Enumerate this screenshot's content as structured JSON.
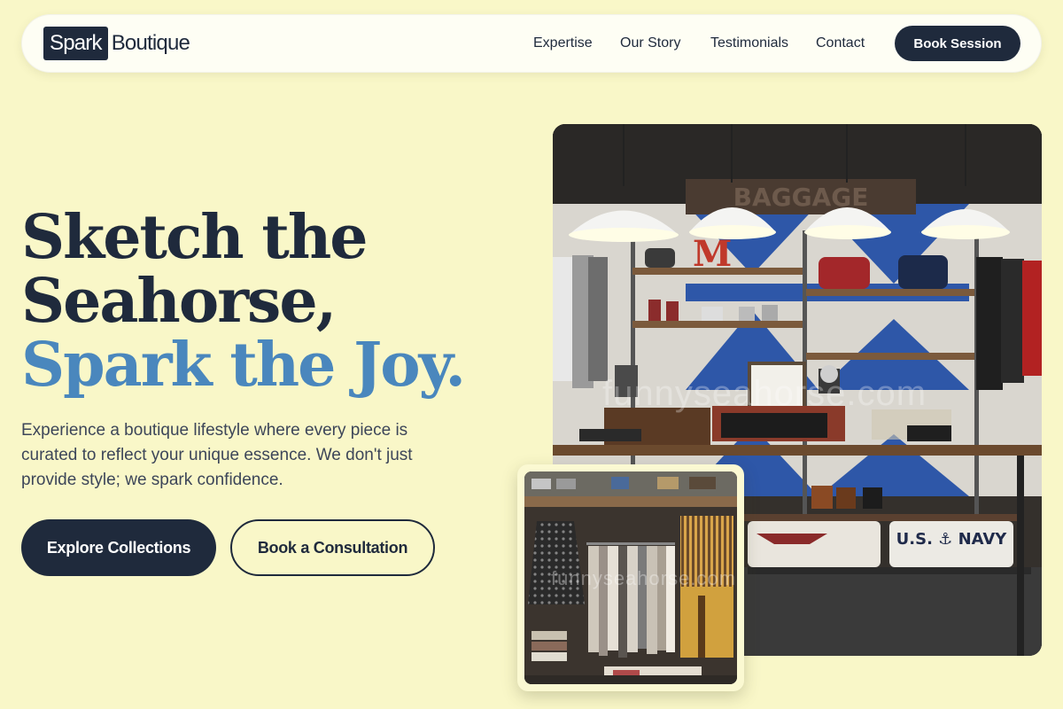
{
  "nav": {
    "logo_box": "Spark",
    "logo_text": "Boutique",
    "links": [
      "Expertise",
      "Our Story",
      "Testimonials",
      "Contact"
    ],
    "cta": "Book Session"
  },
  "hero": {
    "title_line1": "Sketch the",
    "title_line2": "Seahorse,",
    "title_accent": "Spark the Joy.",
    "description": "Experience a boutique lifestyle where every piece is curated to reflect your unique essence. We don't just provide style; we spark confidence.",
    "primary_button": "Explore Collections",
    "secondary_button": "Book a Consultation"
  },
  "images": {
    "main_alt": "Boutique store interior with pendant lamps and shelves",
    "sub_alt": "Clothing rack with dresses",
    "watermark": "funnyseahorse.com",
    "watermark_sub": "funnyseahorse.com",
    "signage": "BAGGAGE",
    "shirt_text": "U.S. ⚓ NAVY",
    "display_letter": "M"
  },
  "colors": {
    "background": "#f9f7c8",
    "navy": "#1f2a3c",
    "accent_blue": "#4a87bd"
  }
}
